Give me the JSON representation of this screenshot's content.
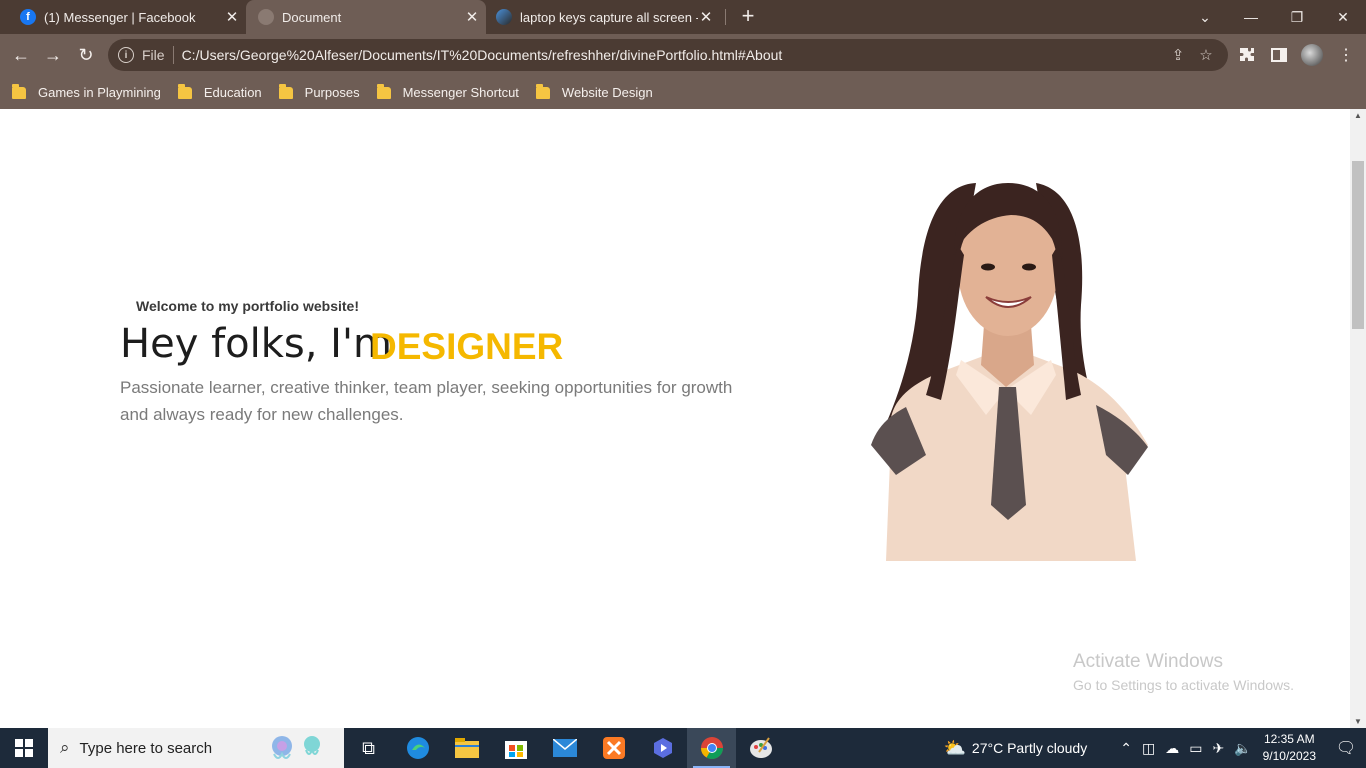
{
  "browser": {
    "tabs": [
      {
        "title": "(1) Messenger | Facebook",
        "favicon": "facebook-icon"
      },
      {
        "title": "Document",
        "favicon": "globe-icon"
      },
      {
        "title": "laptop keys capture all screen - G",
        "favicon": "google-icon"
      }
    ],
    "active_tab": 1,
    "address": {
      "scheme": "File",
      "url": "C:/Users/George%20Alfeser/Documents/IT%20Documents/refreshher/divinePortfolio.html#About"
    },
    "bookmarks": [
      "Games in Playmining",
      "Education",
      "Purposes",
      "Messenger Shortcut",
      "Website Design"
    ]
  },
  "page": {
    "welcome": "Welcome to my portfolio website!",
    "greeting": "Hey folks, I'm",
    "role": "DESIGNER",
    "tagline": "Passionate learner, creative thinker, team player, seeking opportunities for growth and always ready for new challenges."
  },
  "watermark": {
    "title": "Activate Windows",
    "subtitle": "Go to Settings to activate Windows."
  },
  "taskbar": {
    "search_placeholder": "Type here to search",
    "weather": "27°C  Partly cloudy",
    "time": "12:35 AM",
    "date": "9/10/2023"
  },
  "colors": {
    "accent": "#f5b800",
    "frame": "#4b3b33",
    "toolbar": "#6e5d55"
  }
}
